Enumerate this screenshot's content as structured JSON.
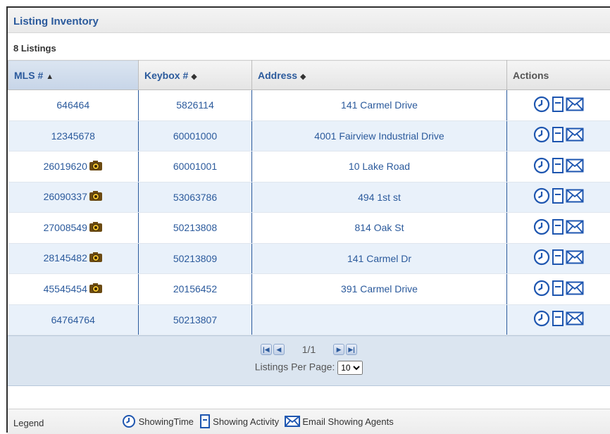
{
  "panel": {
    "title": "Listing Inventory",
    "count": "8 Listings"
  },
  "columns": [
    {
      "label": "MLS #",
      "sort": "▲"
    },
    {
      "label": "Keybox #",
      "sort": "◆"
    },
    {
      "label": "Address",
      "sort": "◆"
    },
    {
      "label": "Actions"
    }
  ],
  "rows": [
    {
      "mls": "646464",
      "keybox": "5826114",
      "address": "141 Carmel Drive",
      "photo": false
    },
    {
      "mls": "12345678",
      "keybox": "60001000",
      "address": "4001 Fairview Industrial Drive",
      "photo": false
    },
    {
      "mls": "26019620",
      "keybox": "60001001",
      "address": "10 Lake Road",
      "photo": true
    },
    {
      "mls": "26090337",
      "keybox": "53063786",
      "address": "494 1st st",
      "photo": true
    },
    {
      "mls": "27008549",
      "keybox": "50213808",
      "address": "814 Oak St",
      "photo": true
    },
    {
      "mls": "28145482",
      "keybox": "50213809",
      "address": "141 Carmel Dr",
      "photo": true
    },
    {
      "mls": "45545454",
      "keybox": "20156452",
      "address": "391 Carmel Drive",
      "photo": true
    },
    {
      "mls": "64764764",
      "keybox": "50213807",
      "address": "",
      "photo": false
    }
  ],
  "pager": {
    "page_text": "1/1",
    "per_page_label": "Listings Per Page:",
    "per_page_value": "10"
  },
  "legend": {
    "title": "Legend",
    "items": [
      "ShowingTime",
      "Showing Activity",
      "Email Showing Agents"
    ]
  },
  "colors": {
    "link": "#2b5a9c",
    "icon_blue": "#1e56b0",
    "alt_row": "#e9f1fa",
    "pager_bg": "#dbe5f0"
  },
  "icons": {
    "showingtime": "clock-icon",
    "activity": "document-icon",
    "email": "envelope-icon",
    "photo": "camera-icon"
  }
}
